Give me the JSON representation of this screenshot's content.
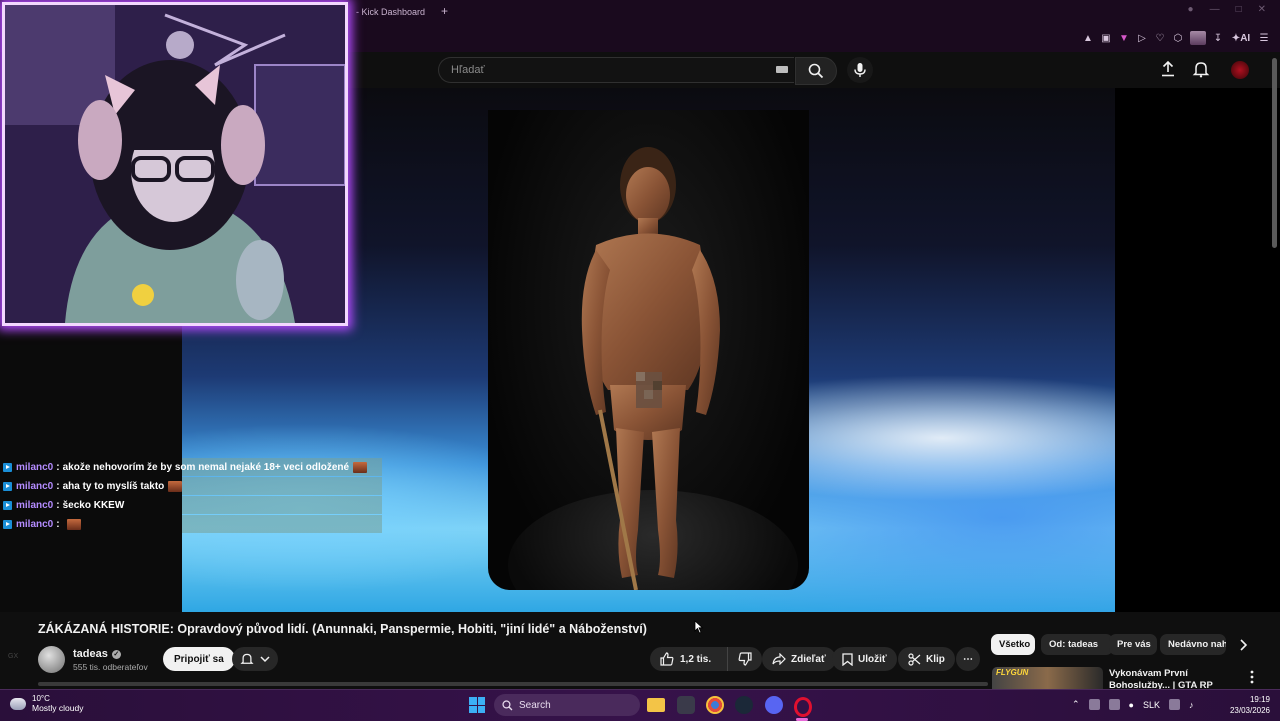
{
  "browser": {
    "tab_title": "- Kick Dashboard",
    "new_tab": "+",
    "ai_label": "AI"
  },
  "youtube": {
    "search": {
      "placeholder": "Hľadať"
    },
    "video": {
      "title": "ZÁKÁZANÁ HISTORIE: Opravdový původ lidí. (Anunnaki, Panspermie, Hobiti, \"jiní lidé\" a Náboženství)",
      "channel": "tadeas",
      "subscribers": "555 tis. odberateľov",
      "join_label": "Pripojiť sa",
      "likes": "1,2 tis.",
      "share_label": "Zdieľať",
      "save_label": "Uložiť",
      "clip_label": "Klip",
      "more_label": "⋯"
    },
    "chips": [
      "Všetko",
      "Od: tadeas",
      "Pre vás",
      "Nedávno nah"
    ],
    "recommendation": {
      "thumb_label": "FLYGUN",
      "title": "Vykonávam První Bohoslužby... | GTA RP"
    }
  },
  "chat": [
    {
      "user": "milanc0",
      "message": "akože nehovorím že by som nemal nejaké 18+ veci odložené",
      "emote": true
    },
    {
      "user": "milanc0",
      "message": "aha ty to myslíš takto",
      "emote": true
    },
    {
      "user": "milanc0",
      "message": "šecko KKEW",
      "emote": false
    },
    {
      "user": "milanc0",
      "message": "",
      "emote": true
    }
  ],
  "taskbar": {
    "weather_temp": "10°C",
    "weather_desc": "Mostly cloudy",
    "search_label": "Search",
    "language": "SLK",
    "time": "19:19",
    "date": "23/03/2026",
    "gx": "GX"
  },
  "colors": {
    "webcam_border": "#f3d8ff",
    "webcam_glow": "#b44bff",
    "chat_user": "#b48cff",
    "yt_bg": "#0f0f0f"
  }
}
